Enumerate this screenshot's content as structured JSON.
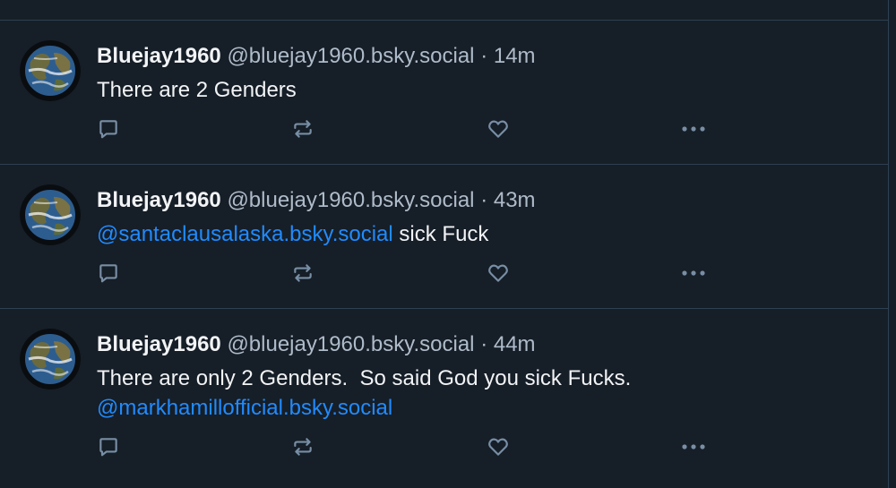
{
  "posts": [
    {
      "display_name": "Bluejay1960",
      "handle": "@bluejay1960.bsky.social",
      "separator": "·",
      "time": "14m",
      "line1_mention": "",
      "line1_text": "There are 2 Genders",
      "line2_mention": ""
    },
    {
      "display_name": "Bluejay1960",
      "handle": "@bluejay1960.bsky.social",
      "separator": "·",
      "time": "43m",
      "line1_mention": "@santaclausalaska.bsky.social",
      "line1_text": " sick Fuck",
      "line2_mention": ""
    },
    {
      "display_name": "Bluejay1960",
      "handle": "@bluejay1960.bsky.social",
      "separator": "·",
      "time": "44m",
      "line1_mention": "",
      "line1_text": "There are only 2 Genders.  So said God you sick Fucks.",
      "line2_mention": "@markhamillofficial.bsky.social"
    }
  ],
  "icons": {
    "reply": "reply-icon",
    "repost": "repost-icon",
    "like": "like-icon",
    "more": "more-icon",
    "avatar": "globe-avatar"
  },
  "colors": {
    "background": "#161e27",
    "divider": "#2e4052",
    "text": "#f1f3f5",
    "muted": "#aebbc9",
    "link": "#208bfe",
    "icon": "#788ea5"
  }
}
